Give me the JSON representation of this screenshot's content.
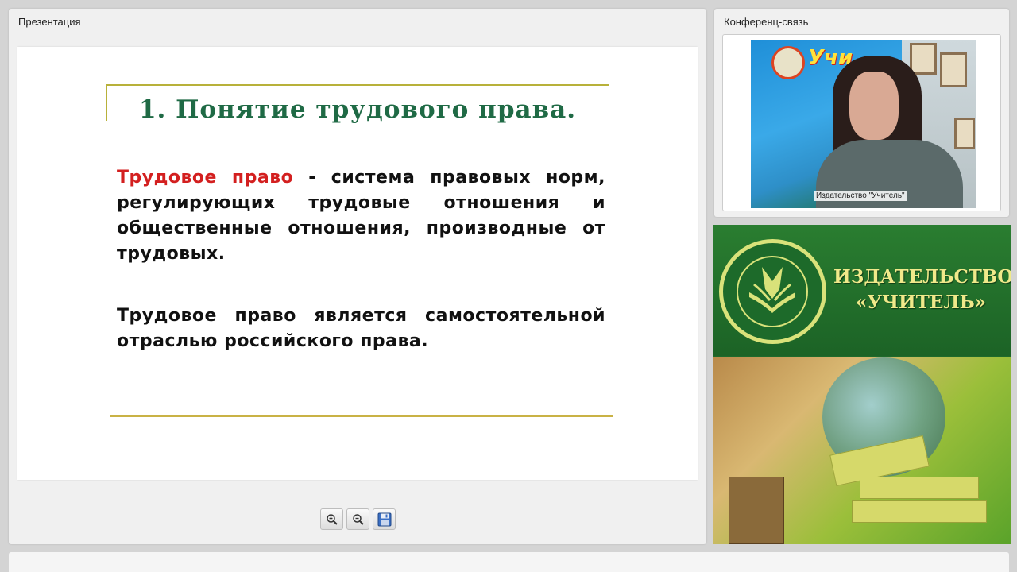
{
  "presentation": {
    "panel_title": "Презентация",
    "slide": {
      "title": "1. Понятие трудового права.",
      "paragraph1_term": "Трудовое право",
      "paragraph1_rest": " - система правовых норм, регулирующих трудовые отношения и общественные отношения, производные от трудовых.",
      "paragraph2": "Трудовое право является самостоятельной отраслью российского права."
    },
    "toolbar": [
      {
        "name": "zoom-in-button",
        "icon": "zoom-in-icon"
      },
      {
        "name": "zoom-out-button",
        "icon": "zoom-out-icon"
      },
      {
        "name": "save-button",
        "icon": "floppy-disk-icon"
      }
    ]
  },
  "conference": {
    "panel_title": "Конференц-связь",
    "video_caption": "Издательство \"Учитель\"",
    "banner_word": "Учи"
  },
  "publisher": {
    "line1": "ИЗДАТЕЛЬСТВО",
    "line2": "«УЧИТЕЛЬ»"
  },
  "colors": {
    "title_green": "#1f6a45",
    "term_red": "#d31f1f",
    "banner_green": "#1e6a2b",
    "banner_text": "#f0e98a"
  }
}
